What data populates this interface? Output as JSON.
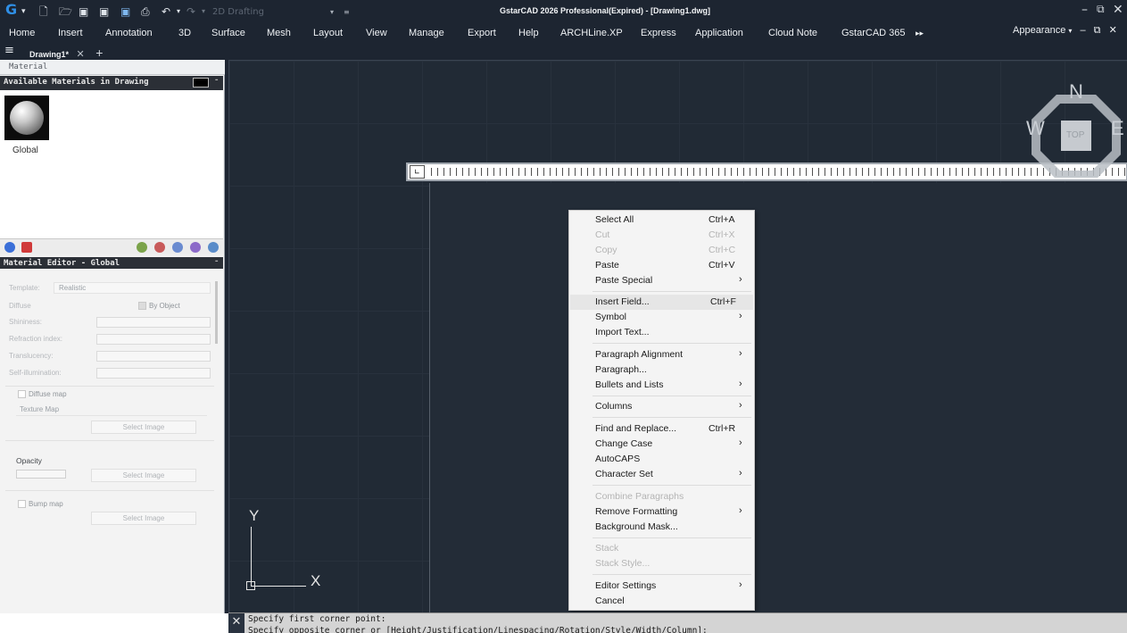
{
  "titlebar": {
    "title": "GstarCAD 2026 Professional(Expired) - [Drawing1.dwg]",
    "workspace": "2D Drafting"
  },
  "menu": {
    "items": [
      "Home",
      "Insert",
      "Annotation",
      "3D",
      "Surface",
      "Mesh",
      "Layout",
      "View",
      "Manage",
      "Export",
      "Help",
      "ARCHLine.XP",
      "Express",
      "Application",
      "Cloud Note",
      "GstarCAD 365"
    ],
    "appearance": "Appearance"
  },
  "tabs": {
    "document": "Drawing1*"
  },
  "palette": {
    "title": "Material",
    "available_header": "Available Materials in Drawing",
    "material_name": "Global",
    "editor_header": "Material Editor - Global",
    "template_label": "Template:",
    "template_value": "Realistic",
    "diffuse_label": "Diffuse",
    "by_object": "By Object",
    "shininess_label": "Shininess:",
    "refraction_label": "Refraction index:",
    "translucency_label": "Translucency:",
    "self_illum_label": "Self-illumination:",
    "diffuse_map": "Diffuse map",
    "texture_map": "Texture Map",
    "select_image": "Select Image",
    "opacity": "Opacity",
    "bump_map": "Bump map"
  },
  "viewcube": {
    "n": "N",
    "w": "W",
    "e": "E",
    "top": "TOP"
  },
  "ucs": {
    "x": "X",
    "y": "Y"
  },
  "context_menu": {
    "select_all": "Select All",
    "select_all_sc": "Ctrl+A",
    "cut": "Cut",
    "cut_sc": "Ctrl+X",
    "copy": "Copy",
    "copy_sc": "Ctrl+C",
    "paste": "Paste",
    "paste_sc": "Ctrl+V",
    "paste_special": "Paste Special",
    "insert_field": "Insert Field...",
    "insert_field_sc": "Ctrl+F",
    "symbol": "Symbol",
    "import_text": "Import Text...",
    "paragraph_alignment": "Paragraph Alignment",
    "paragraph": "Paragraph...",
    "bullets": "Bullets and Lists",
    "columns": "Columns",
    "find_replace": "Find and Replace...",
    "find_replace_sc": "Ctrl+R",
    "change_case": "Change Case",
    "autocaps": "AutoCAPS",
    "character_set": "Character Set",
    "combine_paragraphs": "Combine Paragraphs",
    "remove_formatting": "Remove Formatting",
    "background_mask": "Background Mask...",
    "stack": "Stack",
    "stack_style": "Stack Style...",
    "editor_settings": "Editor Settings",
    "cancel": "Cancel"
  },
  "command": {
    "line1": "Specify first corner point:",
    "line2": "Specify opposite corner or [Height/Justification/Linespacing/Rotation/Style/Width/Column]:"
  }
}
